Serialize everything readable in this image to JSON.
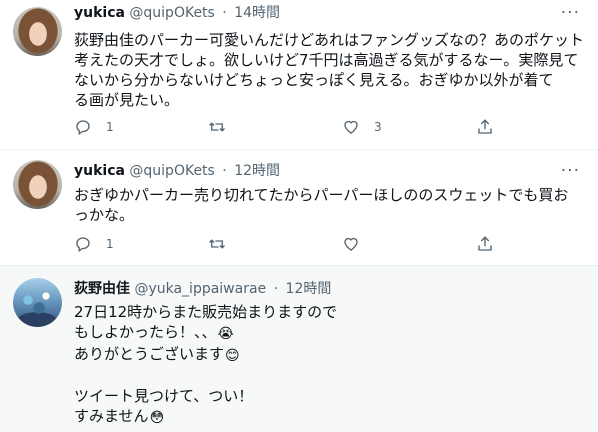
{
  "tweets": [
    {
      "name": "yukica",
      "handle": "@quipOKets",
      "time": "14時間",
      "lines": [
        "荻野由佳のパーカー可愛いんだけどあれはファングッズなの？あのポケット",
        "考えたの天才でしょ。欲しいけど7千円は高過ぎる気がするなー。実際見て",
        "ないから分からないけどちょっと安っぽく見える。おぎゆか以外が着て",
        "る画が見たい。"
      ],
      "reply_count": "1",
      "retweet_count": "",
      "like_count": "3"
    },
    {
      "name": "yukica",
      "handle": "@quipOKets",
      "time": "12時間",
      "lines": [
        "おぎゆかパーカー売り切れてたからパーパーほしののスウェットでも買お",
        "っかな。"
      ],
      "reply_count": "1",
      "retweet_count": "",
      "like_count": ""
    },
    {
      "name": "荻野由佳",
      "handle": "@yuka_ippaiwarae",
      "time": "12時間",
      "lines": [
        "27日12時からまた販売始まりますので",
        "もしよかったら！、、",
        "ありがとうございます",
        "",
        "ツイート見つけて、つい！",
        "すみません"
      ],
      "emojis": [
        "😭",
        "😊",
        "😳"
      ]
    }
  ],
  "separator_dot": "·",
  "more_glyph": "···",
  "icons": {
    "reply": "reply-icon",
    "retweet": "retweet-icon",
    "like": "heart-icon",
    "share": "share-icon",
    "more": "more-icon"
  },
  "colors": {
    "text": "#0f1419",
    "secondary": "#536471",
    "highlight_bg": "#f7f9f9"
  }
}
